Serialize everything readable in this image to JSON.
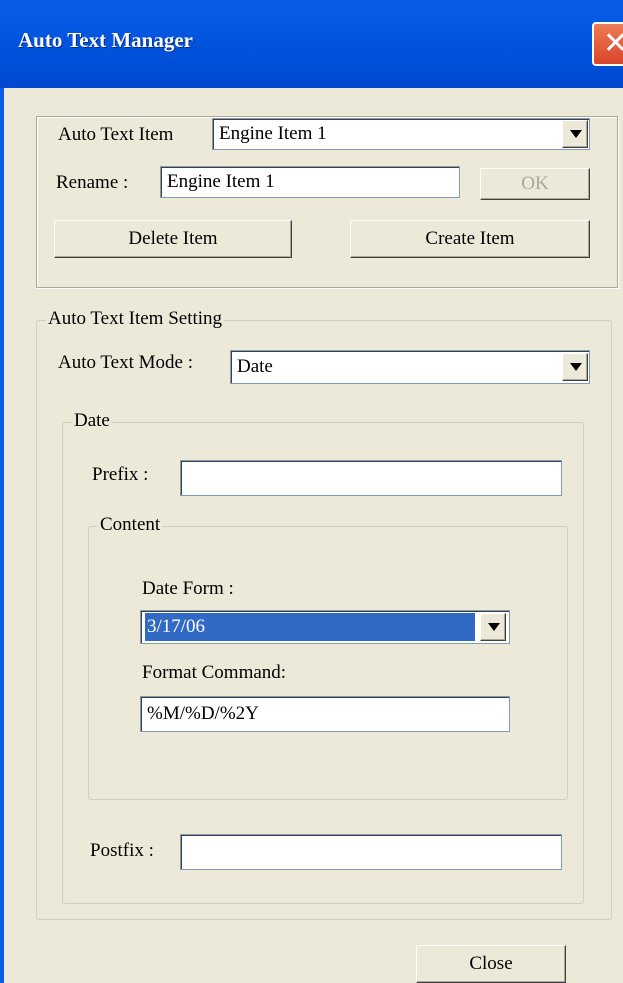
{
  "window": {
    "title": "Auto Text Manager",
    "close_icon": "close-icon"
  },
  "items_section": {
    "auto_text_item_label": "Auto Text Item",
    "auto_text_item_value": "Engine Item 1",
    "rename_label": "Rename :",
    "rename_value": "Engine Item 1",
    "ok_label": "OK",
    "delete_label": "Delete Item",
    "create_label": "Create Item"
  },
  "setting": {
    "legend": "Auto Text Item Setting",
    "mode_label": "Auto Text Mode :",
    "mode_value": "Date",
    "date_group": {
      "legend": "Date",
      "prefix_label": "Prefix :",
      "prefix_value": "",
      "content_legend": "Content",
      "date_form_label": "Date Form :",
      "date_form_value": "3/17/06",
      "format_command_label": "Format Command:",
      "format_command_value": "%M/%D/%2Y",
      "postfix_label": "Postfix :",
      "postfix_value": ""
    }
  },
  "footer": {
    "close_label": "Close"
  },
  "colors": {
    "titlebar": "#0054e3",
    "face": "#ece9d8",
    "selection": "#316ac5",
    "close": "#d8442a"
  }
}
